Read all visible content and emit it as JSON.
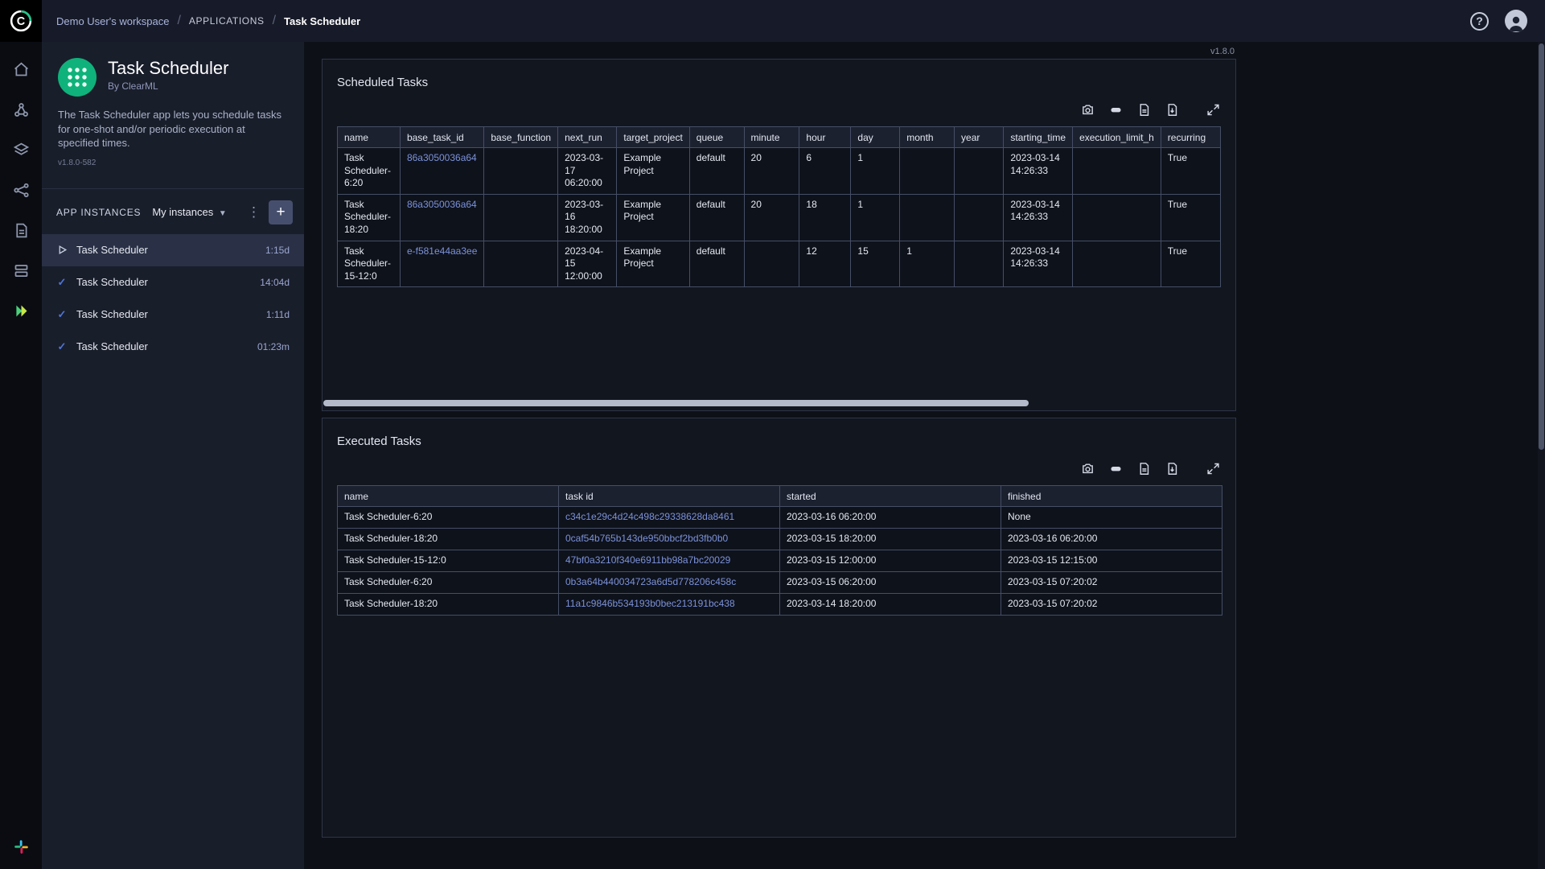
{
  "header": {
    "breadcrumbs": [
      "Demo User's workspace",
      "APPLICATIONS",
      "Task Scheduler"
    ],
    "separator": "/"
  },
  "sidebar": {
    "icons": [
      "home",
      "projects",
      "datasets",
      "pipelines",
      "reports",
      "workers-queues",
      "applications",
      "slack"
    ],
    "active": "applications"
  },
  "app_panel": {
    "title": "Task Scheduler",
    "byline": "By ClearML",
    "description": "The Task Scheduler app lets you schedule tasks for one-shot and/or periodic execution at specified times.",
    "app_version": "v1.8.0-582",
    "instances_header": "APP INSTANCES",
    "instances_filter": "My instances",
    "add_button": "+",
    "instances": [
      {
        "name": "Task Scheduler",
        "time": "1:15d",
        "status": "running",
        "selected": true
      },
      {
        "name": "Task Scheduler",
        "time": "14:04d",
        "status": "completed",
        "selected": false
      },
      {
        "name": "Task Scheduler",
        "time": "1:11d",
        "status": "completed",
        "selected": false
      },
      {
        "name": "Task Scheduler",
        "time": "01:23m",
        "status": "completed",
        "selected": false
      }
    ]
  },
  "main": {
    "version_badge": "v1.8.0",
    "toolbar_icons": [
      "camera",
      "eraser",
      "csv-export",
      "download",
      "maximize"
    ],
    "scheduled": {
      "title": "Scheduled Tasks",
      "columns": [
        "name",
        "base_task_id",
        "base_function",
        "next_run",
        "target_project",
        "queue",
        "minute",
        "hour",
        "day",
        "month",
        "year",
        "starting_time",
        "execution_limit_h",
        "recurring"
      ],
      "link_columns": [
        1
      ],
      "rows": [
        [
          "Task Scheduler-6:20",
          "86a3050036a64",
          "",
          "2023-03-17 06:20:00",
          "Example Project",
          "default",
          "20",
          "6",
          "1",
          "",
          "",
          "2023-03-14 14:26:33",
          "",
          "True"
        ],
        [
          "Task Scheduler-18:20",
          "86a3050036a64",
          "",
          "2023-03-16 18:20:00",
          "Example Project",
          "default",
          "20",
          "18",
          "1",
          "",
          "",
          "2023-03-14 14:26:33",
          "",
          "True"
        ],
        [
          "Task Scheduler-15-12:0",
          "e-f581e44aa3ee",
          "",
          "2023-04-15 12:00:00",
          "Example Project",
          "default",
          "",
          "12",
          "15",
          "1",
          "",
          "2023-03-14 14:26:33",
          "",
          "True"
        ]
      ]
    },
    "executed": {
      "title": "Executed Tasks",
      "columns": [
        "name",
        "task id",
        "started",
        "finished"
      ],
      "link_columns": [
        1
      ],
      "rows": [
        [
          "Task Scheduler-6:20",
          "c34c1e29c4d24c498c29338628da8461",
          "2023-03-16 06:20:00",
          "None"
        ],
        [
          "Task Scheduler-18:20",
          "0caf54b765b143de950bbcf2bd3fb0b0",
          "2023-03-15 18:20:00",
          "2023-03-16 06:20:00"
        ],
        [
          "Task Scheduler-15-12:0",
          "47bf0a3210f340e6911bb98a7bc20029",
          "2023-03-15 12:00:00",
          "2023-03-15 12:15:00"
        ],
        [
          "Task Scheduler-6:20",
          "0b3a64b440034723a6d5d778206c458c",
          "2023-03-15 06:20:00",
          "2023-03-15 07:20:02"
        ],
        [
          "Task Scheduler-18:20",
          "11a1c9846b534193b0bec213191bc438",
          "2023-03-14 18:20:00",
          "2023-03-15 07:20:02"
        ]
      ]
    }
  },
  "colors": {
    "accent_green": "#0fb27a",
    "link_blue": "#7c92da",
    "active_icon_green": "#7ddd4f",
    "check_blue": "#4f75d8"
  }
}
